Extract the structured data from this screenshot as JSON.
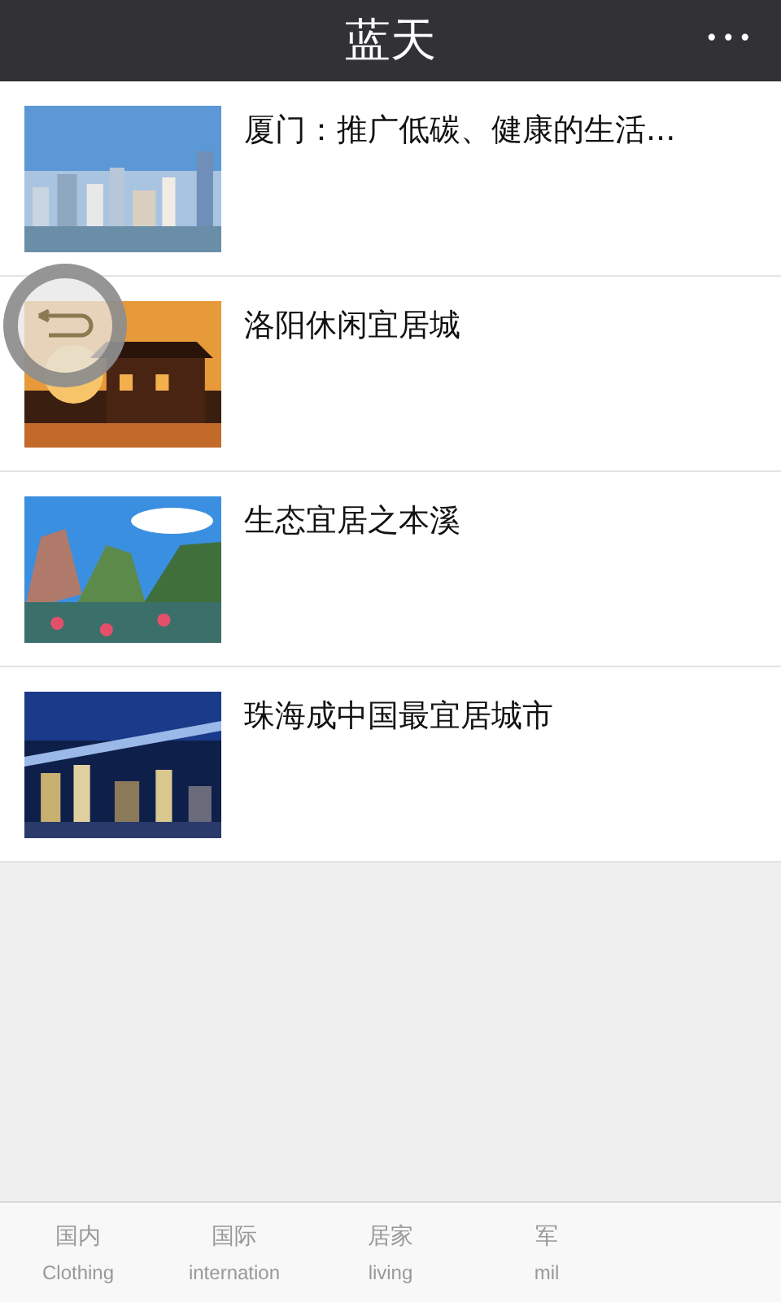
{
  "header": {
    "title": "蓝天",
    "menu": "•••"
  },
  "articles": [
    {
      "title": "厦门：推广低碳、健康的生活..."
    },
    {
      "title": "洛阳休闲宜居城"
    },
    {
      "title": "生态宜居之本溪"
    },
    {
      "title": "珠海成中国最宜居城市"
    }
  ],
  "tab_bar": [
    {
      "label": "国内",
      "sublabel": "Clothing"
    },
    {
      "label": "国际",
      "sublabel": "internation"
    },
    {
      "label": "居家",
      "sublabel": "living"
    },
    {
      "label": "军",
      "sublabel": "mil"
    }
  ]
}
